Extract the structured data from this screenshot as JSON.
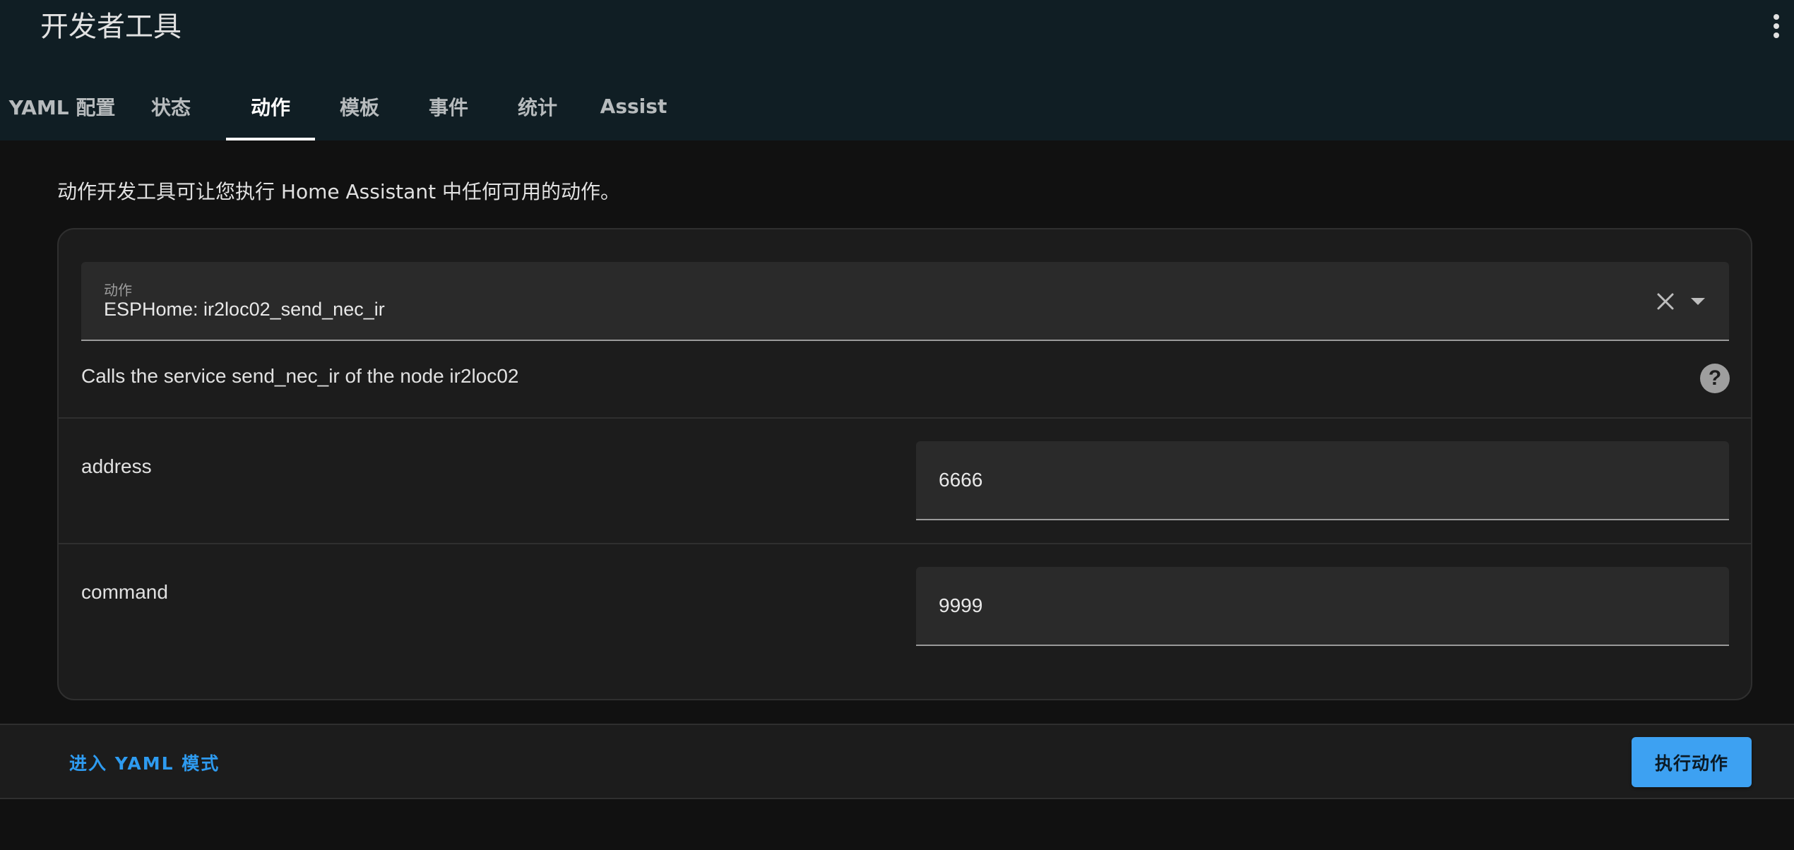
{
  "header": {
    "title": "开发者工具",
    "menu_icon": "dots-vertical-icon"
  },
  "tabs": [
    {
      "label": "YAML 配置",
      "active": false
    },
    {
      "label": "状态",
      "active": false
    },
    {
      "label": "动作",
      "active": true
    },
    {
      "label": "模板",
      "active": false
    },
    {
      "label": "事件",
      "active": false
    },
    {
      "label": "统计",
      "active": false
    },
    {
      "label": "Assist",
      "active": false
    }
  ],
  "main": {
    "intro": "动作开发工具可让您执行 Home Assistant 中任何可用的动作。",
    "action_select": {
      "label": "动作",
      "value": "ESPHome: ir2loc02_send_nec_ir"
    },
    "description": "Calls the service send_nec_ir of the node ir2loc02",
    "fields": [
      {
        "label": "address",
        "value": "6666"
      },
      {
        "label": "command",
        "value": "9999"
      }
    ]
  },
  "footer": {
    "yaml_mode_label": "进入 YAML 模式",
    "run_label": "执行动作"
  },
  "colors": {
    "header_bg": "#101e24",
    "page_bg": "#111111",
    "card_bg": "#1c1c1c",
    "accent": "#3da1f2"
  }
}
